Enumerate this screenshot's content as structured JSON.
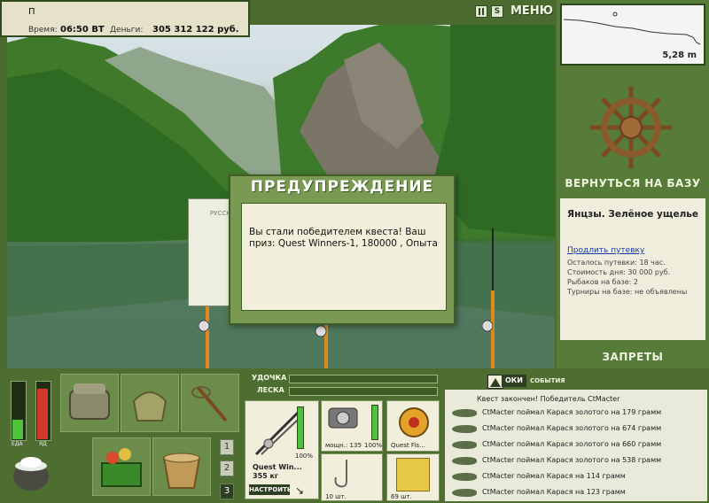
{
  "topbar": {
    "player": "П",
    "time_label": "Время:",
    "time_value": "06:50 ВТ",
    "money_label": "Деньги:",
    "money_value": "305 312 122 руб."
  },
  "menu": {
    "label": "МЕНЮ"
  },
  "depth": {
    "value": "5,28 m"
  },
  "base": {
    "return_label": "ВЕРНУТЬСЯ НА БАЗУ"
  },
  "location": {
    "title": "Янцзы. Зелёное ущелье",
    "extend_link": "Продлить путевку",
    "lines": [
      "Осталось путевки: 18 час.",
      "Стоимость дня: 30 000 руб.",
      "Рыбаков на базе: 2",
      "Турниры на базе: не объявлены"
    ]
  },
  "bans": {
    "label": "ЗАПРЕТЫ"
  },
  "dialog": {
    "title": "ПРЕДУПРЕЖДЕНИЕ",
    "message": "Вы стали победителем квеста! Ваш приз: Quest Winners-1, 180000 , Опыта",
    "bg_label": "РУССК"
  },
  "bars": {
    "rod_label": "УДОЧКА",
    "line_label": "ЛЕСКА"
  },
  "status": {
    "food_label": "ЕДА",
    "poison_label": "ЯД",
    "food_level": 0.35,
    "poison_level": 0.92
  },
  "pages": [
    "1",
    "2",
    "3"
  ],
  "gear": {
    "rod_name": "Quest Win...",
    "rod_weight": "355 кг",
    "rod_percent": "100%",
    "reel_label": "мощн.: 135",
    "reel_percent": "100%",
    "line_name": "Quest Fis...",
    "hook_count": "10 шт.",
    "bait_count": "69 шт.",
    "setup_label": "НАСТРОИТЬ"
  },
  "events": {
    "tab_ok": "ОКИ",
    "tab_events": "СОБЫТИЯ",
    "quest_text": "Квест закончен! Победитель CtMacter",
    "rows": [
      "CtMacter поймал Карася золотого на 179 грамм",
      "CtMacter поймал Карася золотого на 674 грамм",
      "CtMacter поймал Карася золотого на 660 грамм",
      "CtMacter поймал Карася золотого на 538 грамм",
      "CtMacter поймал Карася на 114 грамм",
      "CtMacter поймал Карася на 123 грамм"
    ]
  },
  "colors": {
    "panel": "#577b38",
    "frame": "#2f4a1c",
    "accent": "#e6e1c9"
  }
}
